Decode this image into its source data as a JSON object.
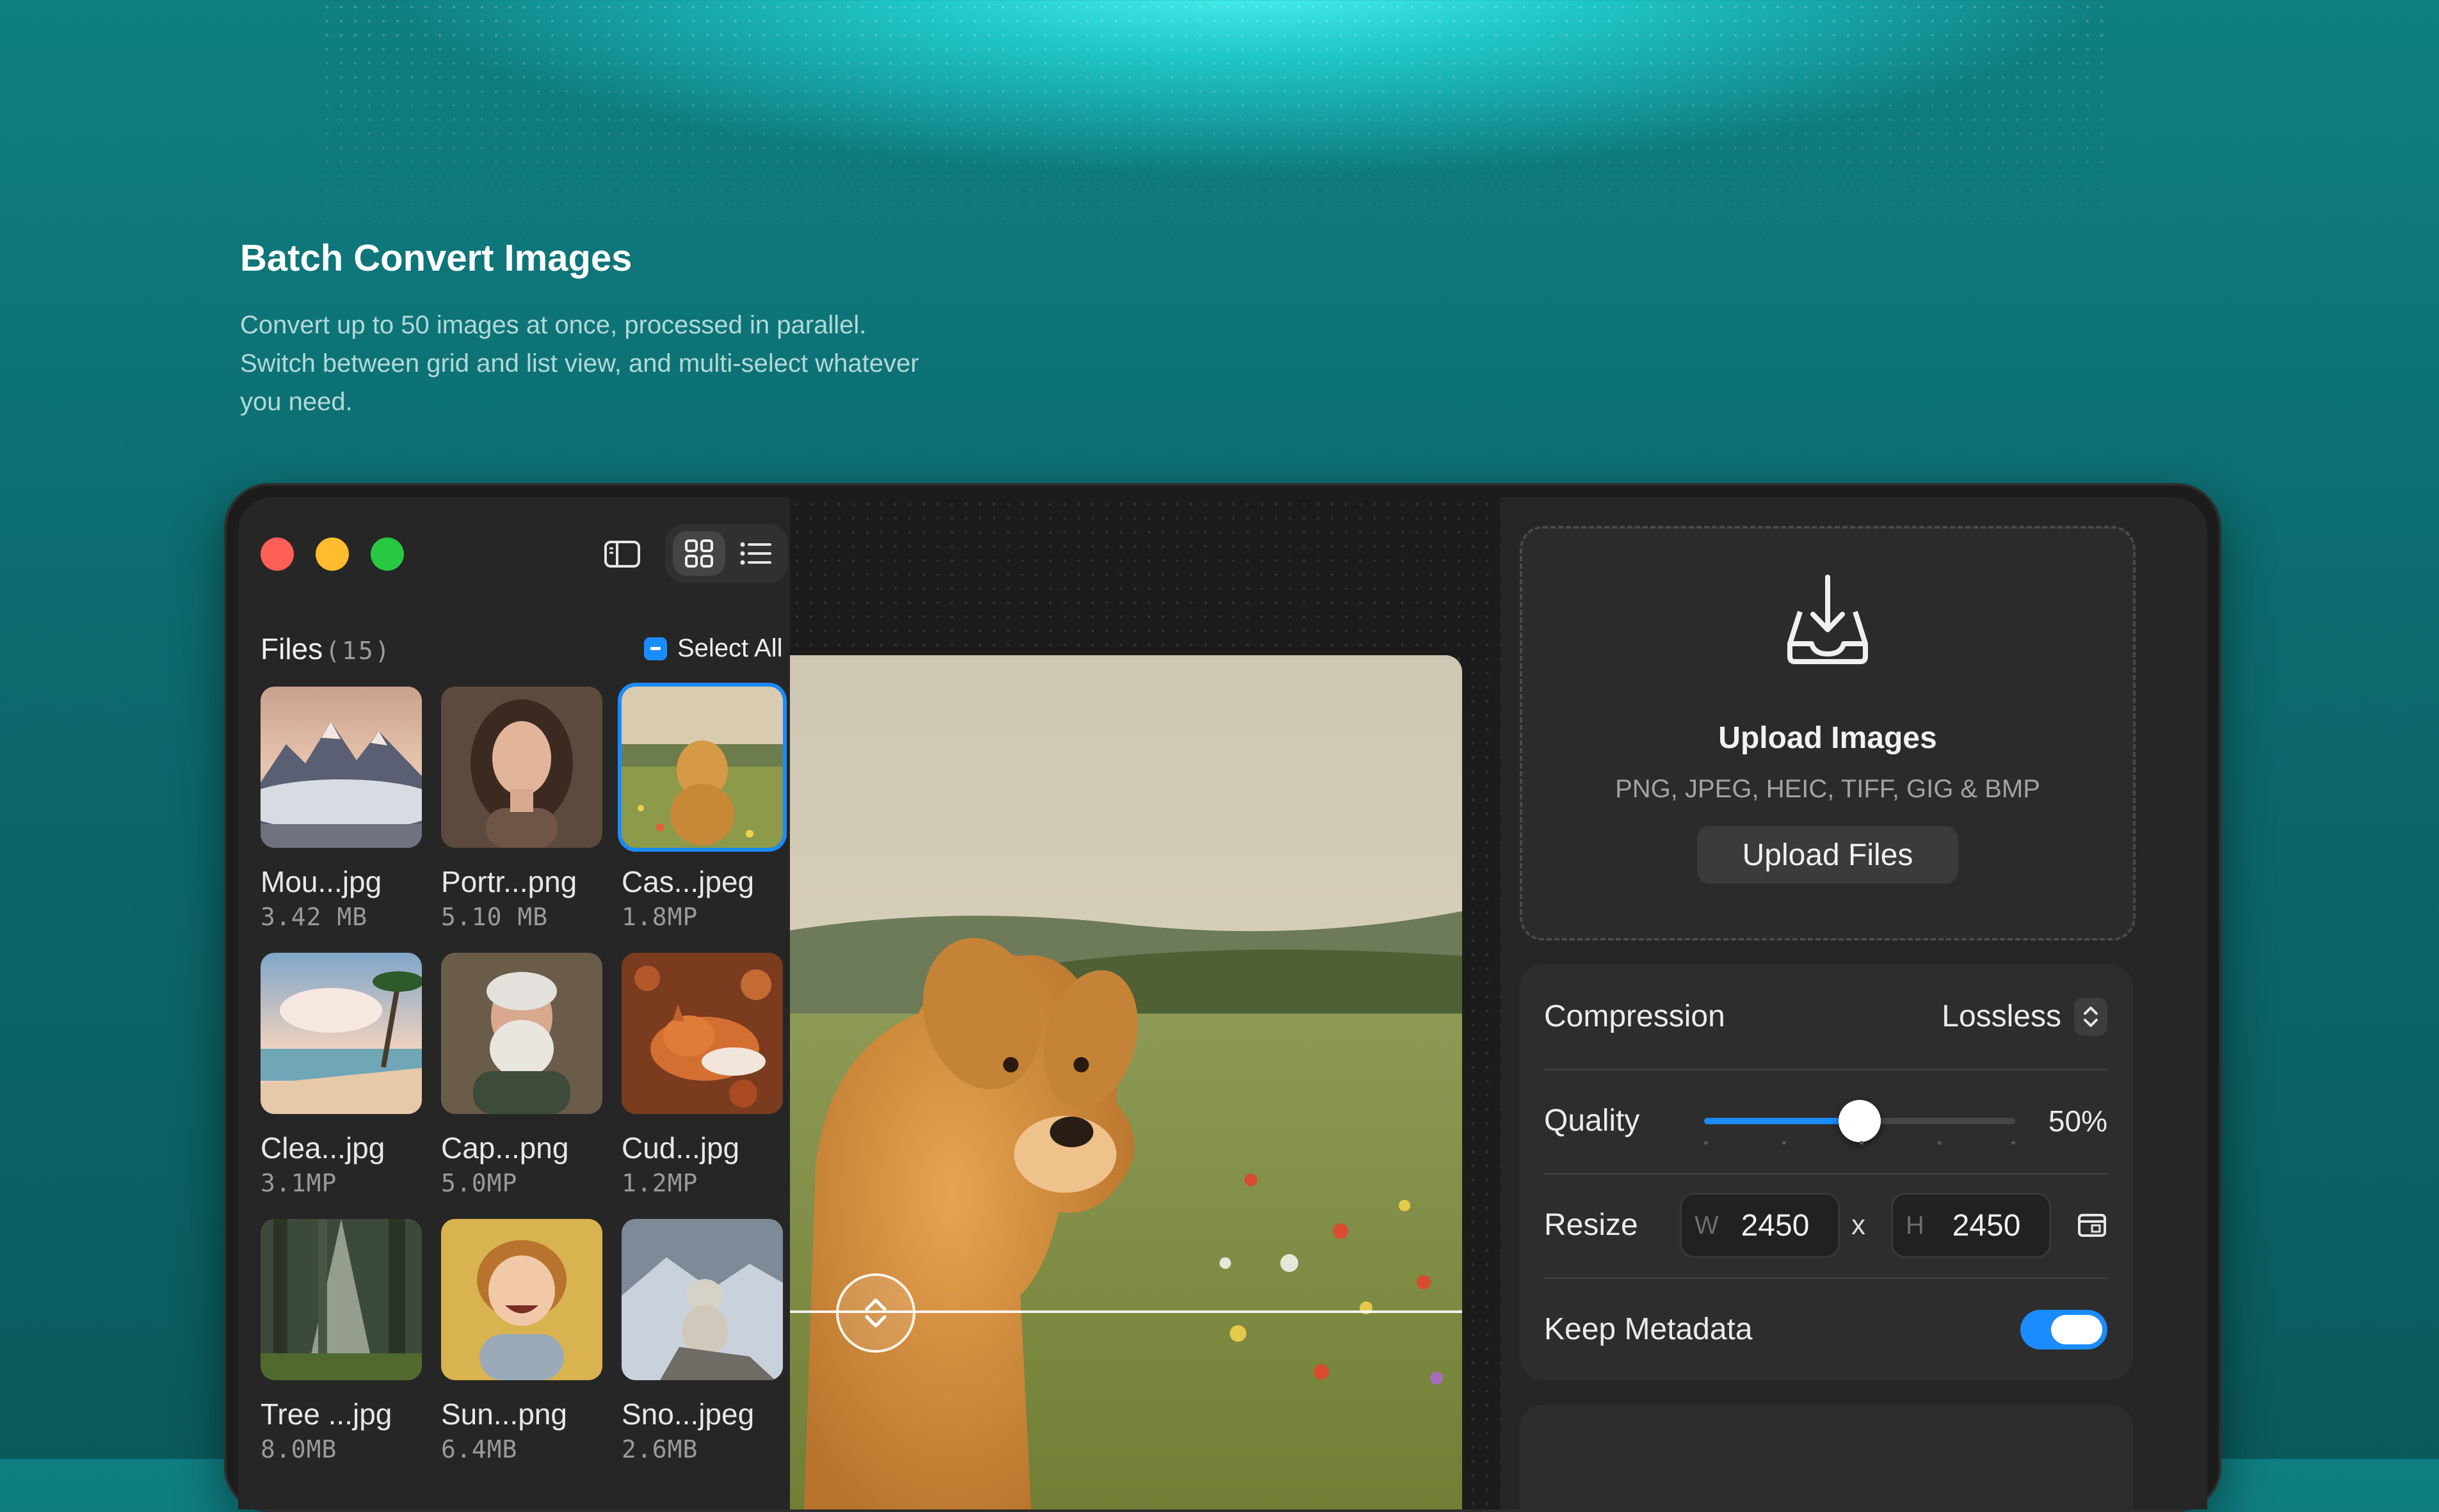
{
  "hero": {
    "title": "Batch Convert Images",
    "description": "Convert up to 50 images at once, processed in parallel. Switch between grid and list view, and multi-select whatever you need."
  },
  "window": {
    "traffic_lights": [
      "close",
      "minimize",
      "zoom"
    ],
    "toolbar_icons": [
      "sidebar-toggle-icon",
      "grid-view-icon",
      "list-view-icon"
    ],
    "active_view": "grid"
  },
  "files": {
    "label": "Files",
    "count": "(15)",
    "select_all_label": "Select All",
    "items": [
      {
        "name": "Mou...jpg",
        "meta": "3.42 MB",
        "selected": false
      },
      {
        "name": "Portr...png",
        "meta": "5.10 MB",
        "selected": false
      },
      {
        "name": "Cas...jpeg",
        "meta": "1.8MP",
        "selected": true
      },
      {
        "name": "Clea...jpg",
        "meta": "3.1MP",
        "selected": false
      },
      {
        "name": "Cap...png",
        "meta": "5.0MP",
        "selected": false
      },
      {
        "name": "Cud...jpg",
        "meta": "1.2MP",
        "selected": false
      },
      {
        "name": "Tree ...jpg",
        "meta": "8.0MB",
        "selected": false
      },
      {
        "name": "Sun...png",
        "meta": "6.4MB",
        "selected": false
      },
      {
        "name": "Sno...jpeg",
        "meta": "2.6MB",
        "selected": false
      }
    ]
  },
  "upload": {
    "title": "Upload Images",
    "formats": "PNG, JPEG, HEIC, TIFF, GIG & BMP",
    "button_label": "Upload Files"
  },
  "settings": {
    "compression": {
      "label": "Compression",
      "value": "Lossless"
    },
    "quality": {
      "label": "Quality",
      "value_text": "50%",
      "level": 0.5
    },
    "resize": {
      "label": "Resize",
      "width_prefix": "W",
      "width": "2450",
      "separator": "x",
      "height_prefix": "H",
      "height": "2450"
    },
    "metadata": {
      "label": "Keep Metadata",
      "enabled": true
    }
  },
  "colors": {
    "accent": "#1a8cff",
    "close": "#fe5f57",
    "minimize": "#febc2e",
    "zoom": "#28c840"
  }
}
